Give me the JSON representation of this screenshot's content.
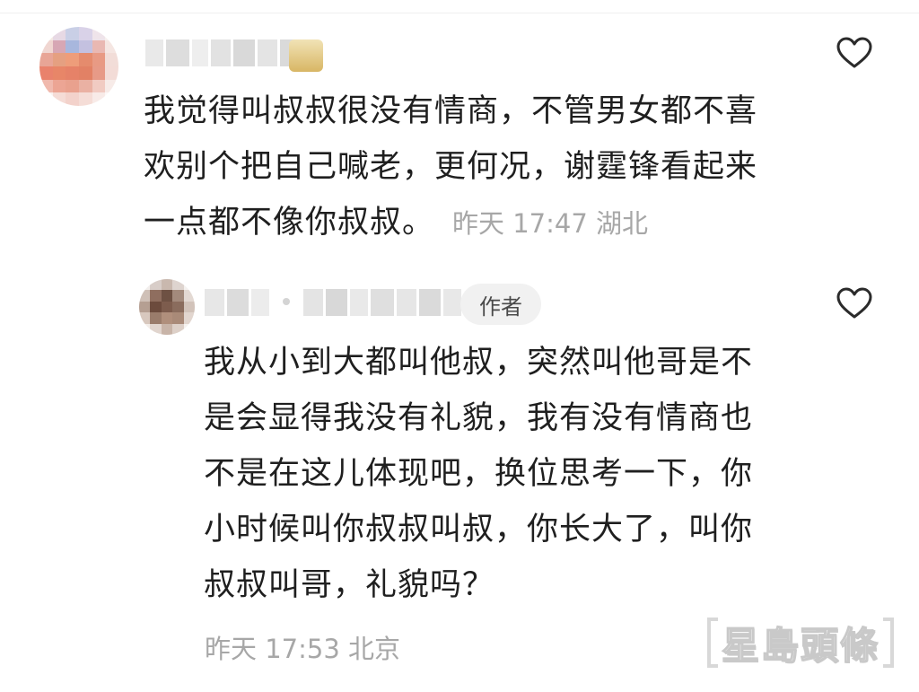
{
  "comments": [
    {
      "text": "我觉得叫叔叔很没有情商，不管男女都不喜欢别个把自己喊老，更何况，谢霆锋看起来一点都不像你叔叔。",
      "time": "昨天 17:47",
      "location": "湖北",
      "like_icon": "heart-outline-icon"
    },
    {
      "badge": "作者",
      "text": "我从小到大都叫他叔，突然叫他哥是不是会显得我没有礼貌，我有没有情商也不是在这儿体现吧，换位思考一下，你小时候叫你叔叔叫叔，你长大了，叫你叔叔叫哥，礼貌吗？",
      "time": "昨天 17:53",
      "location": "北京",
      "like_icon": "heart-outline-icon"
    }
  ],
  "watermark": {
    "text": "星島頭條"
  },
  "colors": {
    "text": "#1f1f1f",
    "meta": "#a7a7a7",
    "badge_bg": "#f1f1f1",
    "icon": "#2b2b2b"
  }
}
